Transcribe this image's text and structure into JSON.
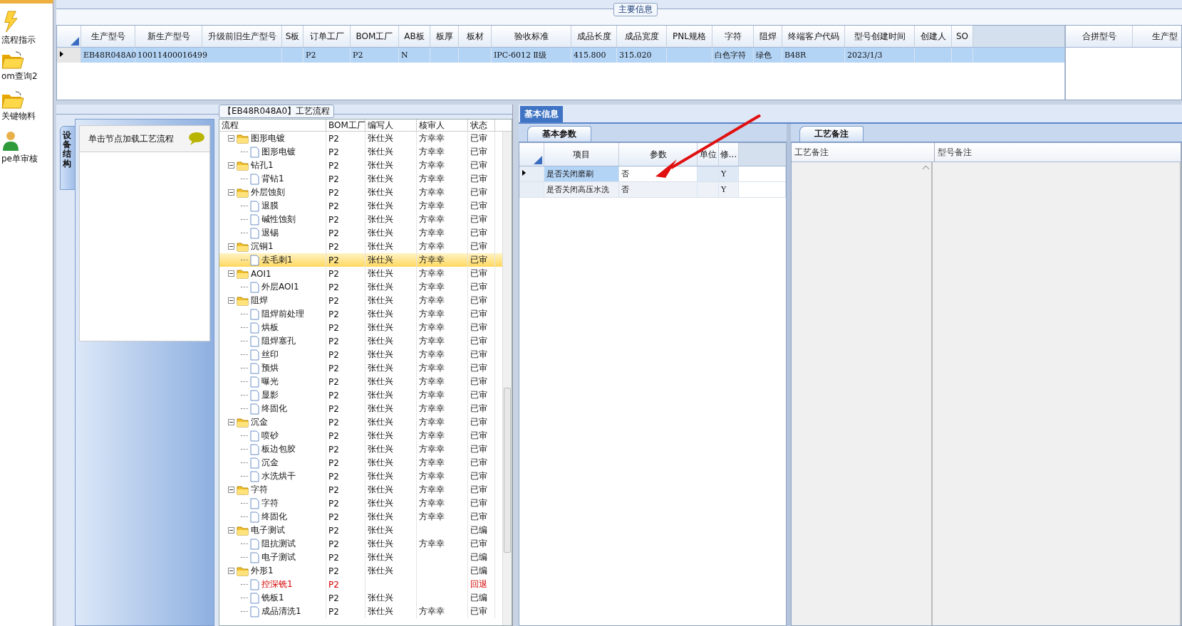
{
  "sidebar": {
    "items": [
      {
        "label": "流程指示",
        "kind": "bolt"
      },
      {
        "label": "om查询2",
        "kind": "folder"
      },
      {
        "label": "关键物料",
        "kind": "folder"
      },
      {
        "label": "pe单审核",
        "kind": "person"
      }
    ]
  },
  "main_info": {
    "title": "主要信息",
    "columns": [
      "生产型号",
      "新生产型号",
      "升级前旧生产型号",
      "S板",
      "订单工厂",
      "BOM工厂",
      "AB板",
      "板厚",
      "板材",
      "验收标准",
      "成品长度",
      "成品宽度",
      "PNL规格",
      "字符",
      "阻焊",
      "终端客户代码",
      "型号创建时间",
      "创建人",
      "SO"
    ],
    "rows": [
      {
        "selected": true,
        "cells": [
          "EB48R048A0",
          "10011400016499",
          null,
          null,
          "P2",
          "P2",
          "N",
          null,
          null,
          "IPC-6012 Ⅱ级",
          "415.800",
          "315.020",
          null,
          "白色字符",
          "绿色",
          "B48R",
          "2023/1/3",
          null,
          null
        ]
      }
    ],
    "side_columns": [
      "合拼型号",
      "生产型"
    ]
  },
  "structure_tab": {
    "label": "设备结构"
  },
  "hint": {
    "text": "单击节点加载工艺流程"
  },
  "process": {
    "title": "【EB48R048A0】工艺流程",
    "columns": [
      "流程",
      "BOM工厂",
      "编写人",
      "核审人",
      "状态"
    ],
    "rows": [
      {
        "kind": "folder",
        "name": "图形电镀",
        "bom": "P2",
        "writer": "张仕兴",
        "reviewer": "方幸幸",
        "status": "已审",
        "selected": false,
        "returned": false,
        "children": [
          {
            "kind": "leaf",
            "name": "图形电镀",
            "bom": "P2",
            "writer": "张仕兴",
            "reviewer": "方幸幸",
            "status": "已审",
            "selected": false,
            "returned": false
          }
        ]
      },
      {
        "kind": "folder",
        "name": "钻孔1",
        "bom": "P2",
        "writer": "张仕兴",
        "reviewer": "方幸幸",
        "status": "已审",
        "selected": false,
        "returned": false,
        "children": [
          {
            "kind": "leaf",
            "name": "背钻1",
            "bom": "P2",
            "writer": "张仕兴",
            "reviewer": "方幸幸",
            "status": "已审",
            "selected": false,
            "returned": false
          }
        ]
      },
      {
        "kind": "folder",
        "name": "外层蚀刻",
        "bom": "P2",
        "writer": "张仕兴",
        "reviewer": "方幸幸",
        "status": "已审",
        "selected": false,
        "returned": false,
        "children": [
          {
            "kind": "leaf",
            "name": "退膜",
            "bom": "P2",
            "writer": "张仕兴",
            "reviewer": "方幸幸",
            "status": "已审",
            "selected": false,
            "returned": false
          },
          {
            "kind": "leaf",
            "name": "碱性蚀刻",
            "bom": "P2",
            "writer": "张仕兴",
            "reviewer": "方幸幸",
            "status": "已审",
            "selected": false,
            "returned": false
          },
          {
            "kind": "leaf",
            "name": "退锡",
            "bom": "P2",
            "writer": "张仕兴",
            "reviewer": "方幸幸",
            "status": "已审",
            "selected": false,
            "returned": false
          }
        ]
      },
      {
        "kind": "folder",
        "name": "沉铜1",
        "bom": "P2",
        "writer": "张仕兴",
        "reviewer": "方幸幸",
        "status": "已审",
        "selected": false,
        "returned": false,
        "children": [
          {
            "kind": "leaf",
            "name": "去毛刺1",
            "bom": "P2",
            "writer": "张仕兴",
            "reviewer": "方幸幸",
            "status": "已审",
            "selected": true,
            "returned": false
          }
        ]
      },
      {
        "kind": "folder",
        "name": "AOI1",
        "bom": "P2",
        "writer": "张仕兴",
        "reviewer": "方幸幸",
        "status": "已审",
        "selected": false,
        "returned": false,
        "children": [
          {
            "kind": "leaf",
            "name": "外层AOI1",
            "bom": "P2",
            "writer": "张仕兴",
            "reviewer": "方幸幸",
            "status": "已审",
            "selected": false,
            "returned": false
          }
        ]
      },
      {
        "kind": "folder",
        "name": "阻焊",
        "bom": "P2",
        "writer": "张仕兴",
        "reviewer": "方幸幸",
        "status": "已审",
        "selected": false,
        "returned": false,
        "children": [
          {
            "kind": "leaf",
            "name": "阻焊前处理",
            "bom": "P2",
            "writer": "张仕兴",
            "reviewer": "方幸幸",
            "status": "已审",
            "selected": false,
            "returned": false
          },
          {
            "kind": "leaf",
            "name": "烘板",
            "bom": "P2",
            "writer": "张仕兴",
            "reviewer": "方幸幸",
            "status": "已审",
            "selected": false,
            "returned": false
          },
          {
            "kind": "leaf",
            "name": "阻焊塞孔",
            "bom": "P2",
            "writer": "张仕兴",
            "reviewer": "方幸幸",
            "status": "已审",
            "selected": false,
            "returned": false
          },
          {
            "kind": "leaf",
            "name": "丝印",
            "bom": "P2",
            "writer": "张仕兴",
            "reviewer": "方幸幸",
            "status": "已审",
            "selected": false,
            "returned": false
          },
          {
            "kind": "leaf",
            "name": "预烘",
            "bom": "P2",
            "writer": "张仕兴",
            "reviewer": "方幸幸",
            "status": "已审",
            "selected": false,
            "returned": false
          },
          {
            "kind": "leaf",
            "name": "曝光",
            "bom": "P2",
            "writer": "张仕兴",
            "reviewer": "方幸幸",
            "status": "已审",
            "selected": false,
            "returned": false
          },
          {
            "kind": "leaf",
            "name": "显影",
            "bom": "P2",
            "writer": "张仕兴",
            "reviewer": "方幸幸",
            "status": "已审",
            "selected": false,
            "returned": false
          },
          {
            "kind": "leaf",
            "name": "终固化",
            "bom": "P2",
            "writer": "张仕兴",
            "reviewer": "方幸幸",
            "status": "已审",
            "selected": false,
            "returned": false
          }
        ]
      },
      {
        "kind": "folder",
        "name": "沉金",
        "bom": "P2",
        "writer": "张仕兴",
        "reviewer": "方幸幸",
        "status": "已审",
        "selected": false,
        "returned": false,
        "children": [
          {
            "kind": "leaf",
            "name": "喷砂",
            "bom": "P2",
            "writer": "张仕兴",
            "reviewer": "方幸幸",
            "status": "已审",
            "selected": false,
            "returned": false
          },
          {
            "kind": "leaf",
            "name": "板边包胶",
            "bom": "P2",
            "writer": "张仕兴",
            "reviewer": "方幸幸",
            "status": "已审",
            "selected": false,
            "returned": false
          },
          {
            "kind": "leaf",
            "name": "沉金",
            "bom": "P2",
            "writer": "张仕兴",
            "reviewer": "方幸幸",
            "status": "已审",
            "selected": false,
            "returned": false
          },
          {
            "kind": "leaf",
            "name": "水洗烘干",
            "bom": "P2",
            "writer": "张仕兴",
            "reviewer": "方幸幸",
            "status": "已审",
            "selected": false,
            "returned": false
          }
        ]
      },
      {
        "kind": "folder",
        "name": "字符",
        "bom": "P2",
        "writer": "张仕兴",
        "reviewer": "方幸幸",
        "status": "已审",
        "selected": false,
        "returned": false,
        "children": [
          {
            "kind": "leaf",
            "name": "字符",
            "bom": "P2",
            "writer": "张仕兴",
            "reviewer": "方幸幸",
            "status": "已审",
            "selected": false,
            "returned": false
          },
          {
            "kind": "leaf",
            "name": "终固化",
            "bom": "P2",
            "writer": "张仕兴",
            "reviewer": "方幸幸",
            "status": "已审",
            "selected": false,
            "returned": false
          }
        ]
      },
      {
        "kind": "folder",
        "name": "电子测试",
        "bom": "P2",
        "writer": "张仕兴",
        "status": "已编",
        "selected": false,
        "returned": false,
        "children": [
          {
            "kind": "leaf",
            "name": "阻抗测试",
            "bom": "P2",
            "writer": "张仕兴",
            "reviewer": "方幸幸",
            "status": "已审",
            "selected": false,
            "returned": false
          },
          {
            "kind": "leaf",
            "name": "电子测试",
            "bom": "P2",
            "writer": "张仕兴",
            "status": "已编",
            "selected": false,
            "returned": false
          }
        ]
      },
      {
        "kind": "folder",
        "name": "外形1",
        "bom": "P2",
        "writer": "张仕兴",
        "status": "已编",
        "selected": false,
        "returned": false,
        "children": [
          {
            "kind": "leaf",
            "name": "控深铣1",
            "bom": "P2",
            "status": "回退",
            "selected": false,
            "returned": true
          },
          {
            "kind": "leaf",
            "name": "铣板1",
            "bom": "P2",
            "writer": "张仕兴",
            "status": "已编",
            "selected": false,
            "returned": false
          },
          {
            "kind": "leaf",
            "name": "成品清洗1",
            "bom": "P2",
            "writer": "张仕兴",
            "reviewer": "方幸幸",
            "status": "已审",
            "selected": false,
            "returned": false
          }
        ]
      }
    ]
  },
  "basic_info": {
    "tab": "基本信息",
    "params_tab": "基本参数",
    "columns": [
      "项目",
      "参数",
      "单位",
      "修..."
    ],
    "rows": [
      {
        "selected": true,
        "item": "是否关闭磨刷",
        "value": "否",
        "flag": "Y"
      },
      {
        "selected": false,
        "item": "是否关闭高压水洗",
        "value": "否",
        "flag": "Y"
      }
    ],
    "notes_tab": "工艺备注",
    "notes_columns": [
      "工艺备注",
      "型号备注"
    ]
  }
}
